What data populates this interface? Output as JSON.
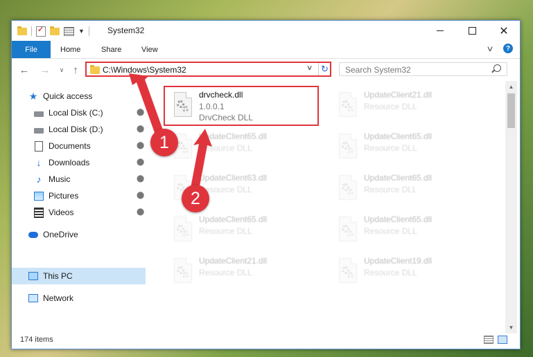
{
  "window": {
    "title": "System32",
    "controls": {
      "minimize": "minimize-icon",
      "maximize": "maximize-icon",
      "close": "✕"
    }
  },
  "ribbon": {
    "tabs": [
      "File",
      "Home",
      "Share",
      "View"
    ],
    "collapse_glyph": "∨",
    "help_glyph": "?"
  },
  "nav": {
    "back_glyph": "←",
    "forward_glyph": "→",
    "recent_glyph": "∨",
    "up_glyph": "↑",
    "address": "C:\\Windows\\System32",
    "address_dropdown_glyph": "∨",
    "refresh_glyph": "↻",
    "search_placeholder": "Search System32"
  },
  "sidebar": {
    "items": [
      {
        "label": "Quick access",
        "icon": "star-icon"
      },
      {
        "label": "Local Disk (C:)",
        "icon": "drive-icon",
        "pinned": true
      },
      {
        "label": "Local Disk (D:)",
        "icon": "drive-icon",
        "pinned": true
      },
      {
        "label": "Documents",
        "icon": "document-icon",
        "pinned": true
      },
      {
        "label": "Downloads",
        "icon": "download-icon",
        "pinned": true
      },
      {
        "label": "Music",
        "icon": "music-icon",
        "pinned": true
      },
      {
        "label": "Pictures",
        "icon": "pictures-icon",
        "pinned": true
      },
      {
        "label": "Videos",
        "icon": "videos-icon",
        "pinned": true
      },
      {
        "label": "OneDrive",
        "icon": "cloud-icon"
      },
      {
        "label": "This PC",
        "icon": "computer-icon",
        "selected": true
      },
      {
        "label": "Network",
        "icon": "network-icon"
      }
    ],
    "pin_glyph": "📌"
  },
  "files": {
    "highlighted": {
      "name": "drvcheck.dll",
      "version": "1.0.0.1",
      "description": "DrvCheck DLL"
    },
    "right_column": [
      {
        "name": "UpdateClient21.dll",
        "description": "Resource DLL"
      },
      {
        "name": "UpdateClient65.dll",
        "description": "Resource DLL"
      },
      {
        "name": "UpdateClient65.dll",
        "description": "Resource DLL"
      },
      {
        "name": "UpdateClient65.dll",
        "description": "Resource DLL"
      },
      {
        "name": "UpdateClient19.dll",
        "description": "Resource DLL"
      }
    ],
    "left_column": [
      {
        "name": "UpdateClient65.dll",
        "description": "Resource DLL"
      },
      {
        "name": "UpdateClient63.dll",
        "description": "Resource DLL"
      },
      {
        "name": "UpdateClient65.dll",
        "description": "Resource DLL"
      },
      {
        "name": "UpdateClient21.dll",
        "description": "Resource DLL"
      }
    ]
  },
  "scrollbar": {
    "up_glyph": "▲",
    "down_glyph": "▼"
  },
  "status": {
    "item_count": "174 items"
  },
  "annotations": {
    "badge_1": "1",
    "badge_2": "2",
    "color": "#e0343c"
  },
  "colors": {
    "accent": "#1979ca",
    "selection": "#cce4f7",
    "highlight": "#e0343c"
  }
}
